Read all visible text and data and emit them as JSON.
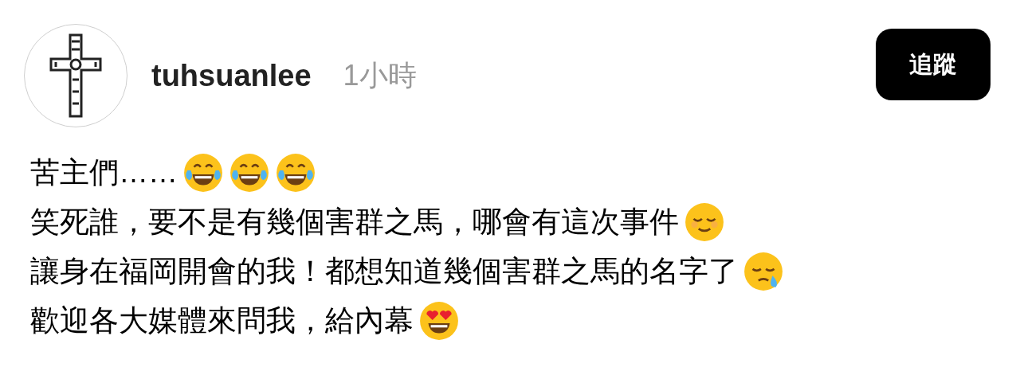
{
  "post": {
    "author": "tuhsuanlee",
    "time": "1小時",
    "follow_button": "追蹤",
    "lines": [
      {
        "text": "苦主們……",
        "emojis": [
          {
            "kind": "tears-of-joy"
          },
          {
            "kind": "tears-of-joy"
          },
          {
            "kind": "tears-of-joy"
          }
        ]
      },
      {
        "text": "笑死誰，要不是有幾個害群之馬，哪會有這次事件",
        "emojis": [
          {
            "kind": "relieved"
          }
        ]
      },
      {
        "text": "讓身在福岡開會的我！都想知道幾個害群之馬的名字了",
        "emojis": [
          {
            "kind": "sleepy"
          }
        ]
      },
      {
        "text": "歡迎各大媒體來問我，給內幕",
        "emojis": [
          {
            "kind": "heart-eyes"
          }
        ]
      }
    ]
  }
}
